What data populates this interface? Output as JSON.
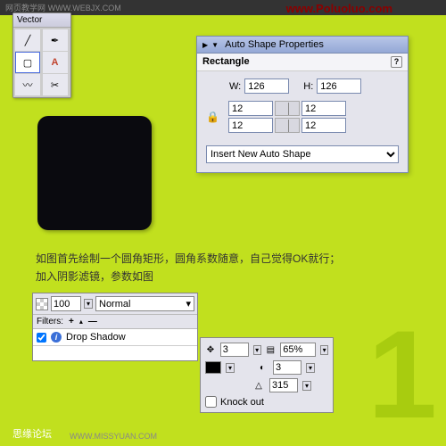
{
  "watermark": {
    "url1": "www.Poluoluo.com",
    "label": "网页教学网",
    "sub": "WWW.WEBJX.COM"
  },
  "vector": {
    "title": "Vector"
  },
  "shapePanel": {
    "title": "Auto Shape Properties",
    "subtitle": "Rectangle",
    "wLabel": "W:",
    "hLabel": "H:",
    "width": "126",
    "height": "126",
    "corners": [
      "12",
      "12",
      "12",
      "12"
    ],
    "insertLabel": "Insert New Auto Shape"
  },
  "cnText": {
    "line1": "如图首先绘制一个圆角矩形，圆角系数随意，自己觉得OK就行；",
    "line2": "加入阴影滤镜，参数如图"
  },
  "filter": {
    "opacity": "100",
    "blend": "Normal",
    "filtersLbl": "Filters:",
    "name": "Drop Shadow"
  },
  "shadow": {
    "dist": "3",
    "opacity": "65%",
    "soft": "3",
    "angle": "315",
    "knock": "Knock out"
  },
  "footer": {
    "name": "思缘论坛",
    "url": "WWW.MISSYUAN.COM"
  }
}
